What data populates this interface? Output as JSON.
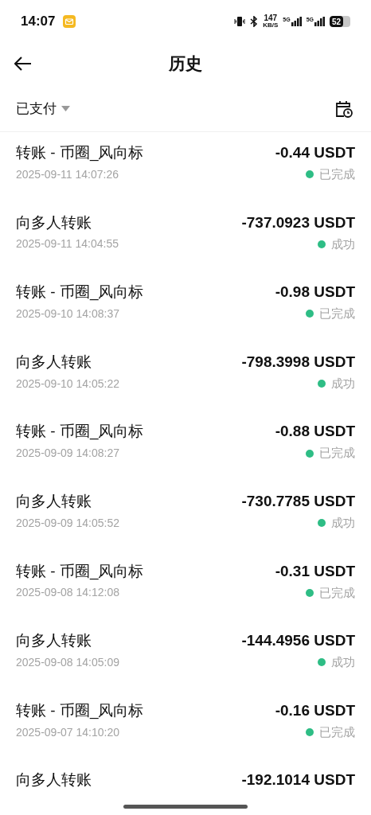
{
  "status_bar": {
    "time": "14:07",
    "net_speed": "147",
    "net_unit": "KB/S",
    "sim_1": "5G",
    "sim_2": "5G",
    "battery": "52"
  },
  "header": {
    "title": "历史"
  },
  "filter": {
    "label": "已支付"
  },
  "transactions": [
    {
      "title": "转账 - 币圈_风向标",
      "amount": "-0.44 USDT",
      "date": "2025-09-11 14:07:26",
      "status": "已完成"
    },
    {
      "title": "向多人转账",
      "amount": "-737.0923 USDT",
      "date": "2025-09-11 14:04:55",
      "status": "成功"
    },
    {
      "title": "转账 - 币圈_风向标",
      "amount": "-0.98 USDT",
      "date": "2025-09-10 14:08:37",
      "status": "已完成"
    },
    {
      "title": "向多人转账",
      "amount": "-798.3998 USDT",
      "date": "2025-09-10 14:05:22",
      "status": "成功"
    },
    {
      "title": "转账 - 币圈_风向标",
      "amount": "-0.88 USDT",
      "date": "2025-09-09 14:08:27",
      "status": "已完成"
    },
    {
      "title": "向多人转账",
      "amount": "-730.7785 USDT",
      "date": "2025-09-09 14:05:52",
      "status": "成功"
    },
    {
      "title": "转账 - 币圈_风向标",
      "amount": "-0.31 USDT",
      "date": "2025-09-08 14:12:08",
      "status": "已完成"
    },
    {
      "title": "向多人转账",
      "amount": "-144.4956 USDT",
      "date": "2025-09-08 14:05:09",
      "status": "成功"
    },
    {
      "title": "转账 - 币圈_风向标",
      "amount": "-0.16 USDT",
      "date": "2025-09-07 14:10:20",
      "status": "已完成"
    },
    {
      "title": "向多人转账",
      "amount": "-192.1014 USDT"
    }
  ]
}
